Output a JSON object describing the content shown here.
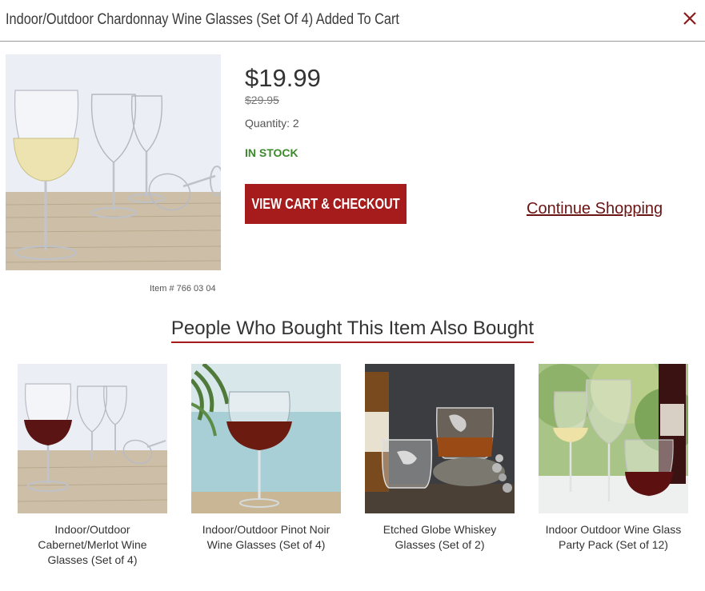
{
  "header": {
    "title": "Indoor/Outdoor Chardonnay Wine Glasses (Set Of 4) Added To Cart",
    "close_icon": "close-icon"
  },
  "product": {
    "price": "$19.99",
    "original_price": "$29.95",
    "quantity": "Quantity: 2",
    "stock_status": "IN STOCK",
    "item_number": "Item # 766 03 04"
  },
  "actions": {
    "checkout_label": "VIEW CART & CHECKOUT",
    "continue_label": "Continue Shopping"
  },
  "recommendations": {
    "title": "People Who Bought This Item Also Bought",
    "items": [
      {
        "name": "Indoor/Outdoor Cabernet/Merlot Wine Glasses (Set of 4)"
      },
      {
        "name": "Indoor/Outdoor Pinot Noir Wine Glasses (Set of 4)"
      },
      {
        "name": "Etched Globe Whiskey Glasses (Set of 2)"
      },
      {
        "name": "Indoor Outdoor Wine Glass Party Pack (Set of 12)"
      }
    ]
  },
  "colors": {
    "accent": "#a61c1c",
    "link": "#6b1414",
    "in_stock": "#3a8a2a"
  }
}
